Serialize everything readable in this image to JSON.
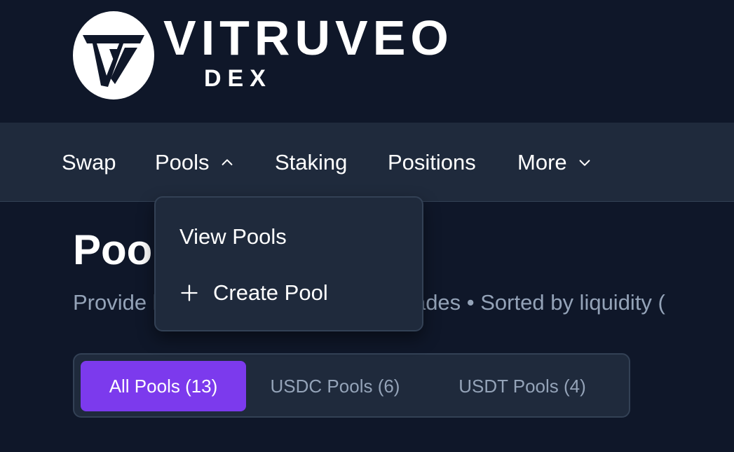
{
  "brand": {
    "name": "VITRUVEO",
    "sub": "DEX"
  },
  "nav": {
    "items": [
      {
        "label": "Swap",
        "icon": null
      },
      {
        "label": "Pools",
        "icon": "chevron-up-icon"
      },
      {
        "label": "Staking",
        "icon": null
      },
      {
        "label": "Positions",
        "icon": null
      },
      {
        "label": "More",
        "icon": "chevron-down-icon"
      }
    ]
  },
  "pools_menu": {
    "items": [
      {
        "label": "View Pools",
        "icon": null
      },
      {
        "label": "Create Pool",
        "icon": "plus-icon"
      }
    ]
  },
  "main": {
    "title": "Pools",
    "subtitle": "Provide liquidity and earn fees on trades • Sorted by liquidity ("
  },
  "tabs": [
    {
      "label": "All Pools (13)",
      "active": true
    },
    {
      "label": "USDC Pools (6)",
      "active": false
    },
    {
      "label": "USDT Pools (4)",
      "active": false
    }
  ],
  "colors": {
    "background": "#0f1729",
    "nav_bg": "#1f2a3c",
    "accent": "#7c3aed",
    "muted_text": "#94a3b8"
  }
}
